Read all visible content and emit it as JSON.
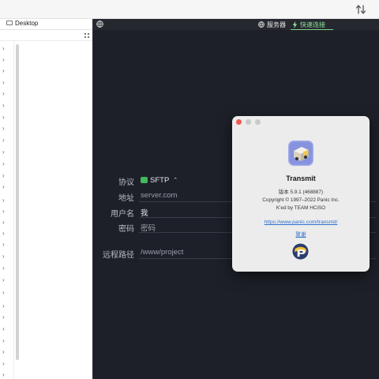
{
  "left_pane": {
    "title": "Desktop",
    "chevron_glyph": "›",
    "chevron_count": 29
  },
  "header": {
    "server_tab": "服务器",
    "quick_connect_tab": "快速连接"
  },
  "form": {
    "protocol_label": "协议",
    "protocol_value": "SFTP",
    "address_label": "地址",
    "address_placeholder": "server.com",
    "username_label": "用户名",
    "username_value": "我",
    "password_label": "密码",
    "password_placeholder": "密码",
    "remote_path_label": "远程路径",
    "remote_path_placeholder": "/www/project"
  },
  "about": {
    "app_name": "Transmit",
    "version": "版本 5.9.1 (468887)",
    "copyright": "Copyright © 1997–2022 Panic Inc.",
    "credit": "K'ed by TEAM HCiSO",
    "url": "https://www.panic.com/transmit/",
    "acknowledgements": "致谢"
  },
  "colors": {
    "main_bg": "#1e2029",
    "quick_connect_accent": "#8fe39a",
    "sftp_badge": "#43b85c",
    "link": "#2f6fd1",
    "close_button": "#ee5b53"
  },
  "icons": [
    "sort-arrows-icon",
    "drive-icon",
    "grid-view-icon",
    "globe-icon",
    "bolt-icon",
    "sftp-icon",
    "stepper-icon",
    "transmit-app-icon",
    "panic-logo-icon"
  ]
}
